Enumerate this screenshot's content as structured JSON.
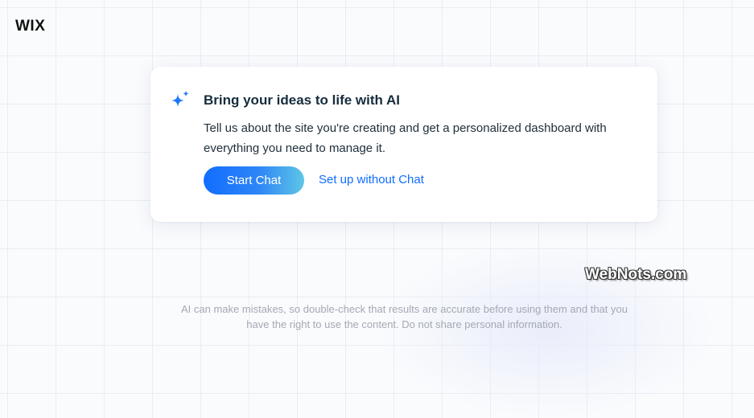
{
  "logo": {
    "text": "WIX"
  },
  "card": {
    "icon": "sparkle-icon",
    "title": "Bring your ideas to life with AI",
    "description": "Tell us about the site you're creating and get a personalized dashboard with everything you need to manage it.",
    "start_chat_label": "Start Chat",
    "setup_without_chat_label": "Set up without Chat"
  },
  "watermark": {
    "text": "WebNots.com"
  },
  "disclaimer": {
    "line1": "AI can make mistakes, so double-check that results are accurate before using them and that you",
    "line2": "have the right to use the content. Do not share personal information."
  },
  "colors": {
    "accent": "#116dff",
    "button_gradient_end": "#5ec6e6",
    "text_dark": "#162d3d",
    "muted_text": "#a3a9b3",
    "background": "#fafbfd"
  }
}
